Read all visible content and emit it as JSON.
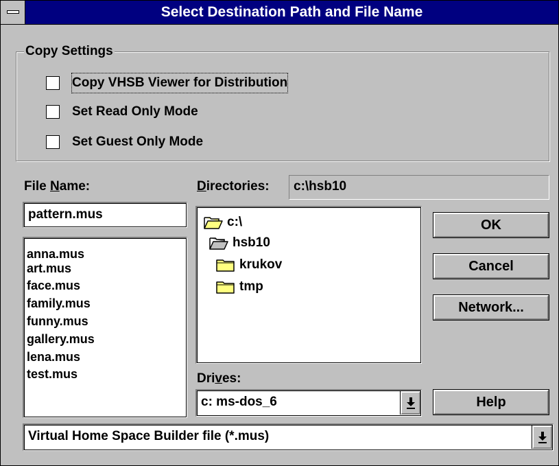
{
  "dialog": {
    "title": "Select Destination Path and File Name"
  },
  "copy_settings": {
    "label": "Copy Settings",
    "options": [
      {
        "label": "Copy VHSB Viewer for Distribution",
        "checked": false
      },
      {
        "label": "Set Read Only Mode",
        "checked": false
      },
      {
        "label": "Set Guest Only Mode",
        "checked": false
      }
    ]
  },
  "file_name": {
    "label_prefix": "File ",
    "label_accel": "N",
    "label_suffix": "ame:",
    "value": "pattern.mus",
    "files": [
      "anna.mus",
      "art.mus",
      "face.mus",
      "family.mus",
      "funny.mus",
      "gallery.mus",
      "lena.mus",
      "test.mus"
    ]
  },
  "directories": {
    "label_accel": "D",
    "label_suffix": "irectories:",
    "current_path": "c:\\hsb10",
    "tree": [
      {
        "label": "c:\\",
        "icon": "open-folder-icon"
      },
      {
        "label": "hsb10",
        "icon": "open-folder-icon"
      },
      {
        "label": "krukov",
        "icon": "closed-folder-icon"
      },
      {
        "label": "tmp",
        "icon": "closed-folder-icon"
      }
    ]
  },
  "drives": {
    "label_prefix": "Dri",
    "label_accel": "v",
    "label_suffix": "es:",
    "value": "c: ms-dos_6"
  },
  "file_type": {
    "value": "Virtual Home Space Builder file (*.mus)"
  },
  "buttons": {
    "ok": "OK",
    "cancel": "Cancel",
    "network": "Network...",
    "help": "Help"
  },
  "colors": {
    "title_bar": "#000080",
    "dialog_face": "#c0c0c0",
    "folder_fill": "#ffff80"
  }
}
